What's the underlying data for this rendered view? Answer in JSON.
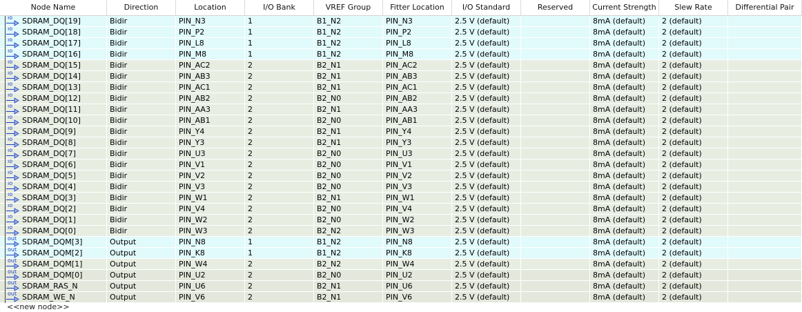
{
  "columns": [
    "Node Name",
    "Direction",
    "Location",
    "I/O Bank",
    "VREF Group",
    "Fitter Location",
    "I/O Standard",
    "Reserved",
    "Current Strength",
    "Slew Rate",
    "Differential Pair"
  ],
  "rows": [
    {
      "name": "SDRAM_DQ[19]",
      "dir": "Bidir",
      "loc": "PIN_N3",
      "bank": "1",
      "vref": "B1_N2",
      "fitter": "PIN_N3",
      "std": "2.5 V (default)",
      "res": "",
      "cur": "8mA (default)",
      "slew": "2 (default)",
      "diff": "",
      "icon": "io",
      "group": "g1"
    },
    {
      "name": "SDRAM_DQ[18]",
      "dir": "Bidir",
      "loc": "PIN_P2",
      "bank": "1",
      "vref": "B1_N2",
      "fitter": "PIN_P2",
      "std": "2.5 V (default)",
      "res": "",
      "cur": "8mA (default)",
      "slew": "2 (default)",
      "diff": "",
      "icon": "io",
      "group": "g1"
    },
    {
      "name": "SDRAM_DQ[17]",
      "dir": "Bidir",
      "loc": "PIN_L8",
      "bank": "1",
      "vref": "B1_N2",
      "fitter": "PIN_L8",
      "std": "2.5 V (default)",
      "res": "",
      "cur": "8mA (default)",
      "slew": "2 (default)",
      "diff": "",
      "icon": "io",
      "group": "g1"
    },
    {
      "name": "SDRAM_DQ[16]",
      "dir": "Bidir",
      "loc": "PIN_M8",
      "bank": "1",
      "vref": "B1_N2",
      "fitter": "PIN_M8",
      "std": "2.5 V (default)",
      "res": "",
      "cur": "8mA (default)",
      "slew": "2 (default)",
      "diff": "",
      "icon": "io",
      "group": "g1"
    },
    {
      "name": "SDRAM_DQ[15]",
      "dir": "Bidir",
      "loc": "PIN_AC2",
      "bank": "2",
      "vref": "B2_N1",
      "fitter": "PIN_AC2",
      "std": "2.5 V (default)",
      "res": "",
      "cur": "8mA (default)",
      "slew": "2 (default)",
      "diff": "",
      "icon": "io",
      "group": "g2"
    },
    {
      "name": "SDRAM_DQ[14]",
      "dir": "Bidir",
      "loc": "PIN_AB3",
      "bank": "2",
      "vref": "B2_N1",
      "fitter": "PIN_AB3",
      "std": "2.5 V (default)",
      "res": "",
      "cur": "8mA (default)",
      "slew": "2 (default)",
      "diff": "",
      "icon": "io",
      "group": "g2"
    },
    {
      "name": "SDRAM_DQ[13]",
      "dir": "Bidir",
      "loc": "PIN_AC1",
      "bank": "2",
      "vref": "B2_N1",
      "fitter": "PIN_AC1",
      "std": "2.5 V (default)",
      "res": "",
      "cur": "8mA (default)",
      "slew": "2 (default)",
      "diff": "",
      "icon": "io",
      "group": "g2"
    },
    {
      "name": "SDRAM_DQ[12]",
      "dir": "Bidir",
      "loc": "PIN_AB2",
      "bank": "2",
      "vref": "B2_N0",
      "fitter": "PIN_AB2",
      "std": "2.5 V (default)",
      "res": "",
      "cur": "8mA (default)",
      "slew": "2 (default)",
      "diff": "",
      "icon": "io",
      "group": "g2"
    },
    {
      "name": "SDRAM_DQ[11]",
      "dir": "Bidir",
      "loc": "PIN_AA3",
      "bank": "2",
      "vref": "B2_N1",
      "fitter": "PIN_AA3",
      "std": "2.5 V (default)",
      "res": "",
      "cur": "8mA (default)",
      "slew": "2 (default)",
      "diff": "",
      "icon": "io",
      "group": "g2"
    },
    {
      "name": "SDRAM_DQ[10]",
      "dir": "Bidir",
      "loc": "PIN_AB1",
      "bank": "2",
      "vref": "B2_N0",
      "fitter": "PIN_AB1",
      "std": "2.5 V (default)",
      "res": "",
      "cur": "8mA (default)",
      "slew": "2 (default)",
      "diff": "",
      "icon": "io",
      "group": "g2"
    },
    {
      "name": "SDRAM_DQ[9]",
      "dir": "Bidir",
      "loc": "PIN_Y4",
      "bank": "2",
      "vref": "B2_N1",
      "fitter": "PIN_Y4",
      "std": "2.5 V (default)",
      "res": "",
      "cur": "8mA (default)",
      "slew": "2 (default)",
      "diff": "",
      "icon": "io",
      "group": "g2"
    },
    {
      "name": "SDRAM_DQ[8]",
      "dir": "Bidir",
      "loc": "PIN_Y3",
      "bank": "2",
      "vref": "B2_N1",
      "fitter": "PIN_Y3",
      "std": "2.5 V (default)",
      "res": "",
      "cur": "8mA (default)",
      "slew": "2 (default)",
      "diff": "",
      "icon": "io",
      "group": "g2"
    },
    {
      "name": "SDRAM_DQ[7]",
      "dir": "Bidir",
      "loc": "PIN_U3",
      "bank": "2",
      "vref": "B2_N0",
      "fitter": "PIN_U3",
      "std": "2.5 V (default)",
      "res": "",
      "cur": "8mA (default)",
      "slew": "2 (default)",
      "diff": "",
      "icon": "io",
      "group": "g2"
    },
    {
      "name": "SDRAM_DQ[6]",
      "dir": "Bidir",
      "loc": "PIN_V1",
      "bank": "2",
      "vref": "B2_N0",
      "fitter": "PIN_V1",
      "std": "2.5 V (default)",
      "res": "",
      "cur": "8mA (default)",
      "slew": "2 (default)",
      "diff": "",
      "icon": "io",
      "group": "g2"
    },
    {
      "name": "SDRAM_DQ[5]",
      "dir": "Bidir",
      "loc": "PIN_V2",
      "bank": "2",
      "vref": "B2_N0",
      "fitter": "PIN_V2",
      "std": "2.5 V (default)",
      "res": "",
      "cur": "8mA (default)",
      "slew": "2 (default)",
      "diff": "",
      "icon": "io",
      "group": "g2"
    },
    {
      "name": "SDRAM_DQ[4]",
      "dir": "Bidir",
      "loc": "PIN_V3",
      "bank": "2",
      "vref": "B2_N0",
      "fitter": "PIN_V3",
      "std": "2.5 V (default)",
      "res": "",
      "cur": "8mA (default)",
      "slew": "2 (default)",
      "diff": "",
      "icon": "io",
      "group": "g2"
    },
    {
      "name": "SDRAM_DQ[3]",
      "dir": "Bidir",
      "loc": "PIN_W1",
      "bank": "2",
      "vref": "B2_N1",
      "fitter": "PIN_W1",
      "std": "2.5 V (default)",
      "res": "",
      "cur": "8mA (default)",
      "slew": "2 (default)",
      "diff": "",
      "icon": "io",
      "group": "g2"
    },
    {
      "name": "SDRAM_DQ[2]",
      "dir": "Bidir",
      "loc": "PIN_V4",
      "bank": "2",
      "vref": "B2_N0",
      "fitter": "PIN_V4",
      "std": "2.5 V (default)",
      "res": "",
      "cur": "8mA (default)",
      "slew": "2 (default)",
      "diff": "",
      "icon": "io",
      "group": "g2"
    },
    {
      "name": "SDRAM_DQ[1]",
      "dir": "Bidir",
      "loc": "PIN_W2",
      "bank": "2",
      "vref": "B2_N0",
      "fitter": "PIN_W2",
      "std": "2.5 V (default)",
      "res": "",
      "cur": "8mA (default)",
      "slew": "2 (default)",
      "diff": "",
      "icon": "io",
      "group": "g2"
    },
    {
      "name": "SDRAM_DQ[0]",
      "dir": "Bidir",
      "loc": "PIN_W3",
      "bank": "2",
      "vref": "B2_N2",
      "fitter": "PIN_W3",
      "std": "2.5 V (default)",
      "res": "",
      "cur": "8mA (default)",
      "slew": "2 (default)",
      "diff": "",
      "icon": "io",
      "group": "g2"
    },
    {
      "name": "SDRAM_DQM[3]",
      "dir": "Output",
      "loc": "PIN_N8",
      "bank": "1",
      "vref": "B1_N2",
      "fitter": "PIN_N8",
      "std": "2.5 V (default)",
      "res": "",
      "cur": "8mA (default)",
      "slew": "2 (default)",
      "diff": "",
      "icon": "out",
      "group": "g1"
    },
    {
      "name": "SDRAM_DQM[2]",
      "dir": "Output",
      "loc": "PIN_K8",
      "bank": "1",
      "vref": "B1_N2",
      "fitter": "PIN_K8",
      "std": "2.5 V (default)",
      "res": "",
      "cur": "8mA (default)",
      "slew": "2 (default)",
      "diff": "",
      "icon": "out",
      "group": "g1"
    },
    {
      "name": "SDRAM_DQM[1]",
      "dir": "Output",
      "loc": "PIN_W4",
      "bank": "2",
      "vref": "B2_N2",
      "fitter": "PIN_W4",
      "std": "2.5 V (default)",
      "res": "",
      "cur": "8mA (default)",
      "slew": "2 (default)",
      "diff": "",
      "icon": "out",
      "group": "g2"
    },
    {
      "name": "SDRAM_DQM[0]",
      "dir": "Output",
      "loc": "PIN_U2",
      "bank": "2",
      "vref": "B2_N0",
      "fitter": "PIN_U2",
      "std": "2.5 V (default)",
      "res": "",
      "cur": "8mA (default)",
      "slew": "2 (default)",
      "diff": "",
      "icon": "out",
      "group": "g3"
    },
    {
      "name": "SDRAM_RAS_N",
      "dir": "Output",
      "loc": "PIN_U6",
      "bank": "2",
      "vref": "B2_N1",
      "fitter": "PIN_U6",
      "std": "2.5 V (default)",
      "res": "",
      "cur": "8mA (default)",
      "slew": "2 (default)",
      "diff": "",
      "icon": "out",
      "group": "g3"
    },
    {
      "name": "SDRAM_WE_N",
      "dir": "Output",
      "loc": "PIN_V6",
      "bank": "2",
      "vref": "B2_N1",
      "fitter": "PIN_V6",
      "std": "2.5 V (default)",
      "res": "",
      "cur": "8mA (default)",
      "slew": "2 (default)",
      "diff": "",
      "icon": "out",
      "group": "g3"
    }
  ],
  "new_node_label": "<<new node>>",
  "colors": {
    "group_bank1": "#e1fafc",
    "group_bank2": "#e8ede2",
    "icon_text": "#1a3fbf"
  }
}
